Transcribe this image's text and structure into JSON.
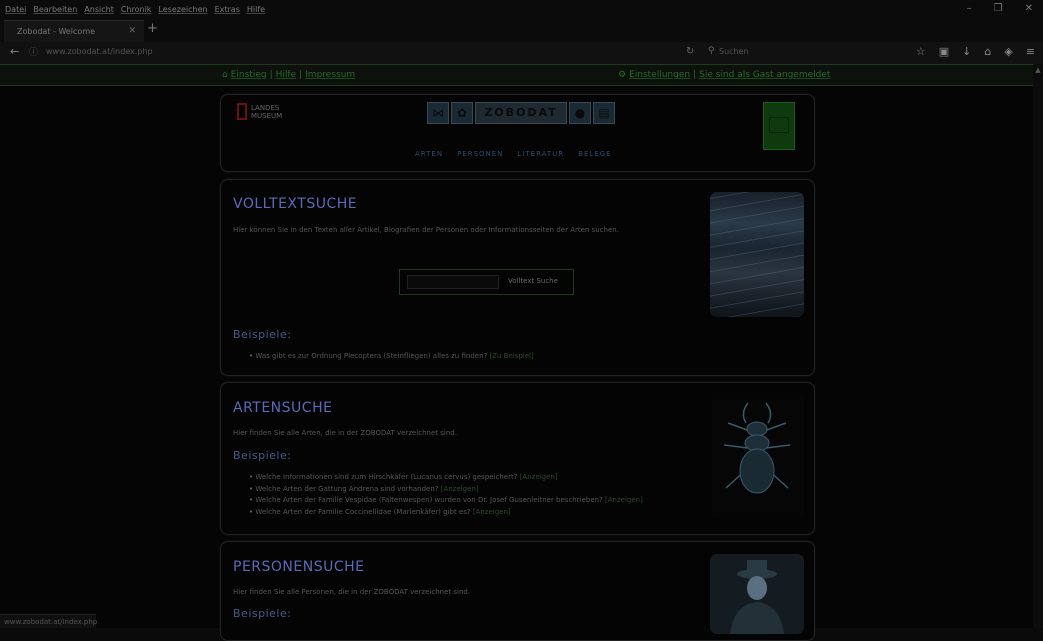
{
  "menubar": [
    "Datei",
    "Bearbeiten",
    "Ansicht",
    "Chronik",
    "Lesezeichen",
    "Extras",
    "Hilfe"
  ],
  "window": {
    "minimize": "–",
    "restore": "❐",
    "close": "✕"
  },
  "tab": {
    "title": "Zobodat - Welcome",
    "close": "✕",
    "new": "+"
  },
  "navbar": {
    "back": "←",
    "info": "ⓘ",
    "url": "www.zobodat.at/index.php",
    "reload": "↻",
    "search_icon": "⚲",
    "search_placeholder": "Suchen",
    "toolbar_icons": [
      "☆",
      "▣",
      "↓",
      "⌂",
      "◈",
      "≡"
    ]
  },
  "greenbar": {
    "left": [
      "Einstieg",
      "Hilfe",
      "Impressum"
    ],
    "right": [
      "Einstellungen",
      "Sie sind als Gast angemeldet"
    ]
  },
  "header": {
    "logo_line1": "LANDES",
    "logo_line2": "MUSEUM",
    "zobodat": "ZOBODAT",
    "nav": [
      "ARTEN",
      "PERSONEN",
      "LITERATUR",
      "BELEGE"
    ]
  },
  "volltext": {
    "title": "VOLLTEXTSUCHE",
    "desc": "Hier können Sie in den Texten aller Artikel, Biografien der Personen oder Informationsseiten der Arten suchen.",
    "button": "Volltext Suche",
    "examples_title": "Beispiele:",
    "examples": [
      {
        "text": "Was gibt es zur Ordnung Plecoptera (Steinfliegen) alles zu finden?",
        "link": "[Zu Beispiel]"
      }
    ]
  },
  "arten": {
    "title": "ARTENSUCHE",
    "desc": "Hier finden Sie alle Arten, die in der ZOBODAT verzeichnet sind.",
    "examples_title": "Beispiele:",
    "examples": [
      {
        "text": "Welche Informationen sind zum Hirschkäfer (Lucanus cervus) gespeichert?",
        "link": "[Anzeigen]"
      },
      {
        "text": "Welche Arten der Gattung Andrena sind vorhanden?",
        "link": "[Anzeigen]"
      },
      {
        "text": "Welche Arten der Familie Vespidae (Faltenwespen) wurden von Dr. Josef Gusenleitner beschrieben?",
        "link": "[Anzeigen]"
      },
      {
        "text": "Welche Arten der Familie Coccinellidae (Marienkäfer) gibt es?",
        "link": "[Anzeigen]"
      }
    ]
  },
  "personen": {
    "title": "PERSONENSUCHE",
    "desc": "Hier finden Sie alle Personen, die in der ZOBODAT verzeichnet sind.",
    "examples_title": "Beispiele:"
  },
  "statusbar": "www.zobodat.at/index.php"
}
